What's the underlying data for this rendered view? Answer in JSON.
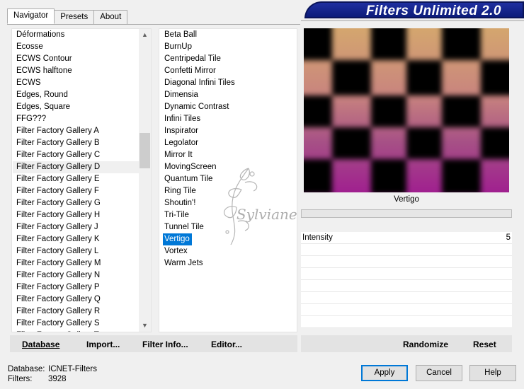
{
  "header": {
    "title": "Filters Unlimited 2.0"
  },
  "tabs": [
    {
      "label": "Navigator",
      "active": true
    },
    {
      "label": "Presets",
      "active": false
    },
    {
      "label": "About",
      "active": false
    }
  ],
  "categories": {
    "items": [
      "Déformations",
      "Ecosse",
      "ECWS Contour",
      "ECWS halftone",
      "ECWS",
      "Edges, Round",
      "Edges, Square",
      "FFG???",
      "Filter Factory Gallery A",
      "Filter Factory Gallery B",
      "Filter Factory Gallery C",
      "Filter Factory Gallery D",
      "Filter Factory Gallery E",
      "Filter Factory Gallery F",
      "Filter Factory Gallery G",
      "Filter Factory Gallery H",
      "Filter Factory Gallery J",
      "Filter Factory Gallery K",
      "Filter Factory Gallery L",
      "Filter Factory Gallery M",
      "Filter Factory Gallery N",
      "Filter Factory Gallery P",
      "Filter Factory Gallery Q",
      "Filter Factory Gallery R",
      "Filter Factory Gallery S",
      "Filter Factory Gallery T"
    ],
    "highlighted": "Filter Factory Gallery D"
  },
  "filters": {
    "items": [
      "Beta Ball",
      "BurnUp",
      "Centripedal Tile",
      "Confetti Mirror",
      "Diagonal Infini Tiles",
      "Dimensia",
      "Dynamic Contrast",
      "Infini Tiles",
      "Inspirator",
      "Legolator",
      "Mirror It",
      "MovingScreen",
      "Quantum Tile",
      "Ring Tile",
      "Shoutin'!",
      "Tri-Tile",
      "Tunnel Tile",
      "Vertigo",
      "Vortex",
      "Warm Jets"
    ],
    "selected": "Vertigo"
  },
  "preview": {
    "caption": "Vertigo"
  },
  "params": [
    {
      "label": "Intensity",
      "value": "5"
    }
  ],
  "toolbar": {
    "database": "Database",
    "import": "Import...",
    "filter_info": "Filter Info...",
    "editor": "Editor..."
  },
  "right_toolbar": {
    "randomize": "Randomize",
    "reset": "Reset"
  },
  "status": {
    "database_label": "Database:",
    "database_value": "ICNET-Filters",
    "filters_label": "Filters:",
    "filters_value": "3928"
  },
  "buttons": {
    "apply": "Apply",
    "cancel": "Cancel",
    "help": "Help"
  },
  "watermark": {
    "text": "Sylviane"
  },
  "colors": {
    "accent": "#0078d7",
    "banner": "#14248c"
  }
}
